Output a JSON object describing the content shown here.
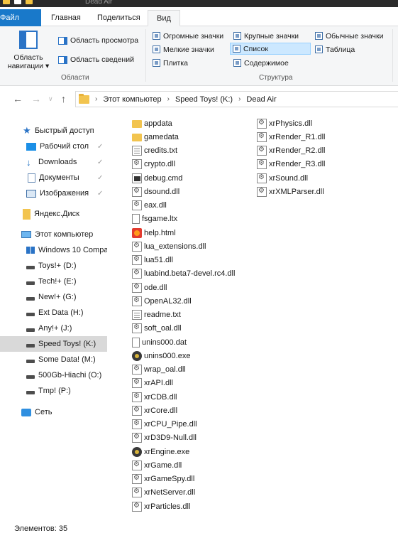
{
  "window": {
    "title": "Dead Air"
  },
  "tabs": [
    {
      "label": "Файл"
    },
    {
      "label": "Главная"
    },
    {
      "label": "Поделиться"
    },
    {
      "label": "Вид"
    }
  ],
  "ribbon": {
    "nav_pane_label": "Область навигации",
    "preview_pane": "Область просмотра",
    "details_pane": "Область сведений",
    "group_panes": "Области",
    "layout": {
      "huge_icons": "Огромные значки",
      "large_icons": "Крупные значки",
      "medium_icons": "Обычные значки",
      "small_icons": "Мелкие значки",
      "list": "Список",
      "table": "Таблица",
      "tiles": "Плитка",
      "content": "Содержимое"
    },
    "group_layout": "Структура"
  },
  "address": {
    "segments": [
      "Этот компьютер",
      "Speed Toys! (K:)",
      "Dead Air"
    ]
  },
  "nav": {
    "quick_access": "Быстрый доступ",
    "desktop": "Рабочий стол",
    "downloads": "Downloads",
    "documents": "Документы",
    "pictures": "Изображения",
    "yandex": "Яндекс.Диск",
    "this_pc": "Этот компьютер",
    "drives": [
      {
        "label": "Windows 10 Compa"
      },
      {
        "label": "Toys!+ (D:)"
      },
      {
        "label": "Tech!+ (E:)"
      },
      {
        "label": "New!+ (G:)"
      },
      {
        "label": "Ext Data (H:)"
      },
      {
        "label": "Any!+ (J:)"
      },
      {
        "label": "Speed Toys! (K:)"
      },
      {
        "label": "Some Data! (M:)"
      },
      {
        "label": "500Gb-Hiachi (O:)"
      },
      {
        "label": "Tmp! (P:)"
      }
    ],
    "network": "Сеть"
  },
  "files": {
    "col1": [
      "appdata",
      "gamedata",
      "credits.txt",
      "crypto.dll",
      "debug.cmd",
      "dsound.dll",
      "eax.dll",
      "fsgame.ltx",
      "help.html",
      "lua_extensions.dll",
      "lua51.dll",
      "luabind.beta7-devel.rc4.dll",
      "ode.dll",
      "OpenAL32.dll",
      "readme.txt",
      "soft_oal.dll",
      "unins000.dat",
      "unins000.exe",
      "wrap_oal.dll",
      "xrAPI.dll",
      "xrCDB.dll",
      "xrCore.dll",
      "xrCPU_Pipe.dll",
      "xrD3D9-Null.dll",
      "xrEngine.exe",
      "xrGame.dll",
      "xrGameSpy.dll",
      "xrNetServer.dll",
      "xrParticles.dll"
    ],
    "col2": [
      "xrPhysics.dll",
      "xrRender_R1.dll",
      "xrRender_R2.dll",
      "xrRender_R3.dll",
      "xrSound.dll",
      "xrXMLParser.dll"
    ]
  },
  "status": {
    "count": "Элементов: 35"
  }
}
